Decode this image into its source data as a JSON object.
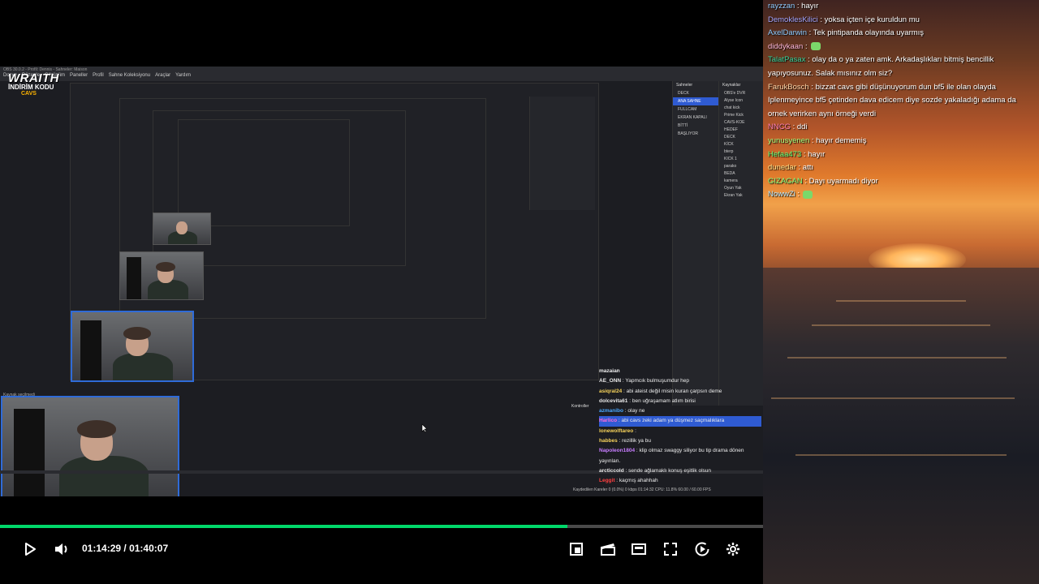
{
  "player": {
    "current_time": "01:14:29",
    "separator": "/",
    "duration": "01:40:07",
    "progress": 0.744
  },
  "obs": {
    "window_title": "OBS 30.0.2 - Profil: Dennis - Sahneler: Maison",
    "menu": [
      "Dosya",
      "Düzenle",
      "Görünüm",
      "Paneller",
      "Profil",
      "Sahne Koleksiyonu",
      "Araçlar",
      "Yardım"
    ],
    "scenes_title": "Sahneler",
    "scenes": [
      "DECK",
      "ANA SAHNE",
      "FULLCAM",
      "EKRAN KAPALI",
      "BİTTİ",
      "BAŞLIYOR"
    ],
    "sources_title": "Kaynaklar",
    "sources": [
      "OBS'e DVR",
      "Alyse Icon",
      "chat kick",
      "Prime Kick",
      "CAVS-KOE",
      "HEDEF",
      "DECK",
      "KİCK",
      "bterp",
      "KICK 1",
      "parako",
      "BEDA",
      "kamera",
      "Oyun Yak",
      "Ekran Yak"
    ],
    "controls_title": "Kontroller",
    "source_select": "Kaynak seçilmedi",
    "status_line": "Kaydedilen Kareler 0 (0.0%)   0 kbps   01:14:32   CPU: 11.8%   60.00 / 60.00 FPS"
  },
  "overlay": {
    "brand": "WRAITH",
    "code_label": "İNDİRİM KODU",
    "code": "CAVS",
    "chat_header": "mazaian",
    "messages": [
      {
        "user": "AE_ONN",
        "text": ": Yapmcık bulmuşumdur hep",
        "color": "#e8e8e8"
      },
      {
        "user": "asiqral24",
        "text": ": abi ateist değil misin kuran çarpsın deme",
        "color": "#f7d35b"
      },
      {
        "user": "dolcevita61",
        "text": ": ben uğraşamam atlım birisi",
        "color": "#e8e8e8"
      },
      {
        "user": "azmanibo",
        "text": ": olay ne",
        "color": "#4aa8ff"
      },
      {
        "user": "Harlico",
        "text": ": abi cavs zeki adam ya düşmez saçmalıklara",
        "color": "#ff6bd5",
        "highlight": true
      },
      {
        "user": "lonewolftareo",
        "text": ":",
        "color": "#f7d35b"
      },
      {
        "user": "habbes",
        "text": ": rezillik ya bu",
        "color": "#f7d35b"
      },
      {
        "user": "Napoleon1804",
        "text": ": klip olmaz swaggy siliyor bu tip drama dönen yayınları.",
        "color": "#c77dff"
      },
      {
        "user": "arcticcold",
        "text": ": sende ağlamaklı konuş eşitlik olsun",
        "color": "#e8e8e8"
      },
      {
        "user": "Leggit",
        "text": ": kaçmış ahahhah",
        "color": "#ff4040"
      }
    ]
  },
  "chat": {
    "messages": [
      {
        "user": "rayzzan",
        "text": ": hayır",
        "color": "#8ecbff"
      },
      {
        "user": "DemoklesKilici",
        "text": ": yoksa içten içe kuruldun mu",
        "color": "#a6a6ff"
      },
      {
        "user": "AxelDarwin",
        "text": ": Tek pintipanda olayında uyarmış",
        "color": "#8ecbff"
      },
      {
        "user": "diddykaan",
        "text": ":",
        "color": "#ffb8d9",
        "emote": true
      },
      {
        "user": "TalatPasax",
        "text": ": olay da o ya zaten amk. Arkadaşlıkları bitmiş bencillik yapıyosunuz. Salak mısınız olm siz?",
        "color": "#34d29b"
      },
      {
        "user": "FarukBosch",
        "text": ": bizzat cavs gibi düşünuyorum dun bf5 ile olan olayda Iplenmeyince bf5 çetinden dava edicem diye sozde yakaladığı adama da ornek verirken aynı örneği verdi",
        "color": "#ffd5a8"
      },
      {
        "user": "NNCG",
        "text": ": ddi",
        "color": "#ff7fb5"
      },
      {
        "user": "yunusyenen",
        "text": ": hayır dememiş",
        "color": "#a6ff7f"
      },
      {
        "user": "Hefaa473",
        "text": ": hayır",
        "color": "#5cff7a"
      },
      {
        "user": "dunedar",
        "text": ": attı",
        "color": "#ffe08a"
      },
      {
        "user": "GIZAGAN",
        "text": ": Dayı uyarmadı diyor",
        "color": "#7fff7f"
      },
      {
        "user": "NowwZi",
        "text": ":",
        "color": "#b7e8ff",
        "emote": true
      }
    ]
  },
  "colors": {
    "progress": "#00d86a",
    "highlight": "#2f5bd2"
  }
}
